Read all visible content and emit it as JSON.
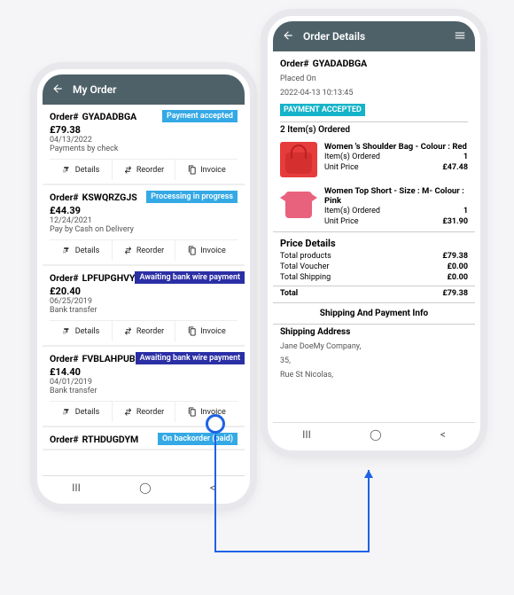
{
  "left": {
    "title": "My Order",
    "btn": {
      "details": "Details",
      "reorder": "Reorder",
      "invoice": "Invoice"
    },
    "orders": [
      {
        "prefix": "Order#",
        "num": "GYADADBGA",
        "amount": "£79.38",
        "date": "04/13/2022",
        "method": "Payments by check",
        "status": "Payment accepted",
        "color": "#34a9e5"
      },
      {
        "prefix": "Order#",
        "num": "KSWQRZGJS",
        "amount": "£44.39",
        "date": "12/24/2021",
        "method": "Pay by Cash on Delivery",
        "status": "Processing in progress",
        "color": "#34a9e5"
      },
      {
        "prefix": "Order#",
        "num": "LPFUPGHVY",
        "amount": "£20.40",
        "date": "06/25/2019",
        "method": "Bank transfer",
        "status": "Awaiting bank wire payment",
        "color": "#2b2fa5"
      },
      {
        "prefix": "Order#",
        "num": "FVBLAHPUB",
        "amount": "£14.40",
        "date": "04/01/2019",
        "method": "Bank transfer",
        "status": "Awaiting bank wire payment",
        "color": "#2b2fa5"
      },
      {
        "prefix": "Order#",
        "num": "RTHDUGDYM",
        "amount": "",
        "date": "",
        "method": "",
        "status": "On backorder (paid)",
        "color": "#34a9e5"
      }
    ]
  },
  "right": {
    "title": "Order Details",
    "order": {
      "prefix": "Order#",
      "num": "GYADADBGA",
      "placedLabel": "Placed On",
      "placed": "2022-04-13 10:13:45",
      "status": "PAYMENT ACCEPTED",
      "statusColor": "#15b3c9"
    },
    "itemsHeader": "2  Item(s) Ordered",
    "items": [
      {
        "title": "Women 's Shoulder Bag - Colour : Red",
        "qtyLabel": "Item(s) Ordered",
        "qty": "1",
        "upLabel": "Unit Price",
        "up": "£47.48",
        "shape": "bag"
      },
      {
        "title": "Women Top Short - Size : M- Colour : Pink",
        "qtyLabel": "Item(s) Ordered",
        "qty": "1",
        "upLabel": "Unit Price",
        "up": "£31.90",
        "shape": "shirt"
      }
    ],
    "priceTitle": "Price Details",
    "price": {
      "products": {
        "l": "Total products",
        "v": "£79.38"
      },
      "voucher": {
        "l": "Total Voucher",
        "v": "£0.00"
      },
      "shipping": {
        "l": "Total Shipping",
        "v": "£0.00"
      },
      "total": {
        "l": "Total",
        "v": "£79.38"
      }
    },
    "shipTitle": "Shipping And Payment Info",
    "shipLabel": "Shipping Address",
    "shipLines": [
      "Jane DoeMy Company,",
      "35,",
      "Rue St Nicolas,"
    ]
  }
}
